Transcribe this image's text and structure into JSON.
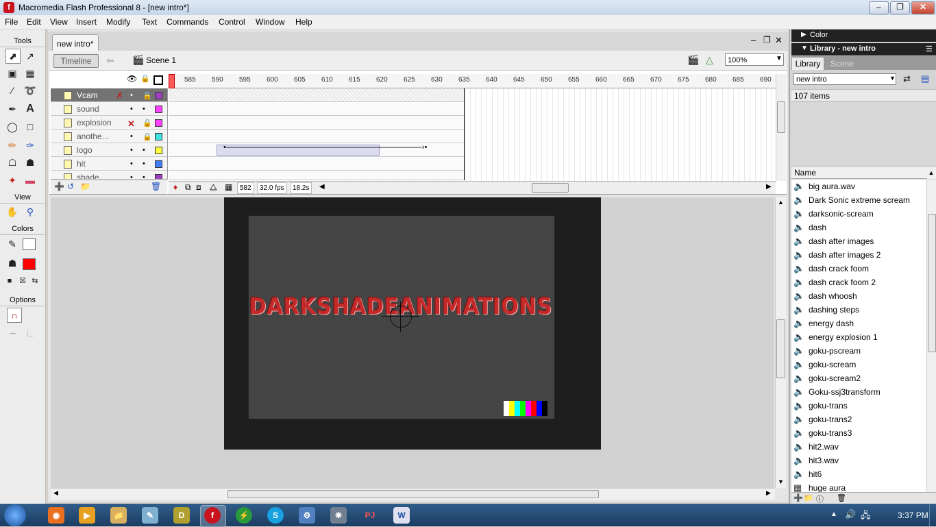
{
  "window": {
    "title": "Macromedia Flash Professional 8 - [new intro*]",
    "app_icon": "f"
  },
  "menu": [
    "File",
    "Edit",
    "View",
    "Insert",
    "Modify",
    "Text",
    "Commands",
    "Control",
    "Window",
    "Help"
  ],
  "tools_panel": {
    "title": "Tools",
    "view_label": "View",
    "colors_label": "Colors",
    "options_label": "Options"
  },
  "document": {
    "tab_label": "new intro*",
    "timeline_button": "Timeline",
    "scene_label": "Scene 1",
    "zoom": "100%"
  },
  "timeline": {
    "layers": [
      {
        "name": "Vcam",
        "selected": true,
        "color": "#a040c0"
      },
      {
        "name": "sound",
        "selected": false,
        "color": "#ff40ff"
      },
      {
        "name": "explosion",
        "selected": false,
        "color": "#ff40ff"
      },
      {
        "name": "anothe...",
        "selected": false,
        "color": "#40e0e0"
      },
      {
        "name": "logo",
        "selected": false,
        "color": "#ffff40"
      },
      {
        "name": "hit",
        "selected": false,
        "color": "#4080ff"
      },
      {
        "name": "shade",
        "selected": false,
        "color": "#a040c0"
      }
    ],
    "frame_numbers": [
      "585",
      "590",
      "595",
      "600",
      "605",
      "610",
      "615",
      "620",
      "625",
      "630",
      "635",
      "640",
      "645",
      "650",
      "655",
      "660",
      "665",
      "670",
      "675",
      "680",
      "685",
      "690"
    ],
    "current_frame": "582",
    "fps": "32.0 fps",
    "time": "18.2s"
  },
  "stage": {
    "title_text": "DARKSHADEANIMATIONS",
    "stage_color": "#454545",
    "title_color": "#c42a2a",
    "color_bars": [
      "#ffffff",
      "#ffff00",
      "#00ffff",
      "#00ff00",
      "#ff00ff",
      "#ff0000",
      "#0000ff",
      "#000000"
    ]
  },
  "panels": {
    "color_header": "Color",
    "library_header": "Library - new intro",
    "library_tab": "Library",
    "scene_tab": "Scene",
    "library_select": "new intro",
    "item_count": "107 items",
    "name_column": "Name",
    "items": [
      {
        "name": "big aura.wav",
        "icon": "sound-icon"
      },
      {
        "name": "Dark Sonic extreme scream",
        "icon": "sound-icon"
      },
      {
        "name": "darksonic-scream",
        "icon": "sound-icon"
      },
      {
        "name": "dash",
        "icon": "sound-icon"
      },
      {
        "name": "dash after images",
        "icon": "sound-icon"
      },
      {
        "name": "dash after images 2",
        "icon": "sound-icon"
      },
      {
        "name": "dash crack foom",
        "icon": "sound-icon"
      },
      {
        "name": "dash crack foom 2",
        "icon": "sound-icon"
      },
      {
        "name": "dash whoosh",
        "icon": "sound-icon"
      },
      {
        "name": "dashing steps",
        "icon": "sound-icon"
      },
      {
        "name": "energy dash",
        "icon": "sound-icon"
      },
      {
        "name": "energy explosion 1",
        "icon": "sound-icon"
      },
      {
        "name": "goku-pscream",
        "icon": "sound-icon"
      },
      {
        "name": "goku-scream",
        "icon": "sound-icon"
      },
      {
        "name": "goku-scream2",
        "icon": "sound-icon"
      },
      {
        "name": "Goku-ssj3transform",
        "icon": "sound-icon"
      },
      {
        "name": "goku-trans",
        "icon": "sound-icon"
      },
      {
        "name": "goku-trans2",
        "icon": "sound-icon"
      },
      {
        "name": "goku-trans3",
        "icon": "sound-icon"
      },
      {
        "name": "hit2.wav",
        "icon": "sound-icon"
      },
      {
        "name": "hit3.wav",
        "icon": "sound-icon"
      },
      {
        "name": "hit6",
        "icon": "sound-icon"
      },
      {
        "name": "huge aura",
        "icon": "graphic-icon"
      }
    ]
  },
  "taskbar": {
    "clock": "3:37 PM",
    "pinned": [
      "firefox-icon",
      "media-player-icon",
      "explorer-icon",
      "paint-icon",
      "dreamweaver-icon",
      "flash-icon",
      "winamp-icon",
      "skype-icon",
      "settings-icon",
      "bitcomet-icon",
      "pj-icon",
      "word-icon"
    ]
  }
}
